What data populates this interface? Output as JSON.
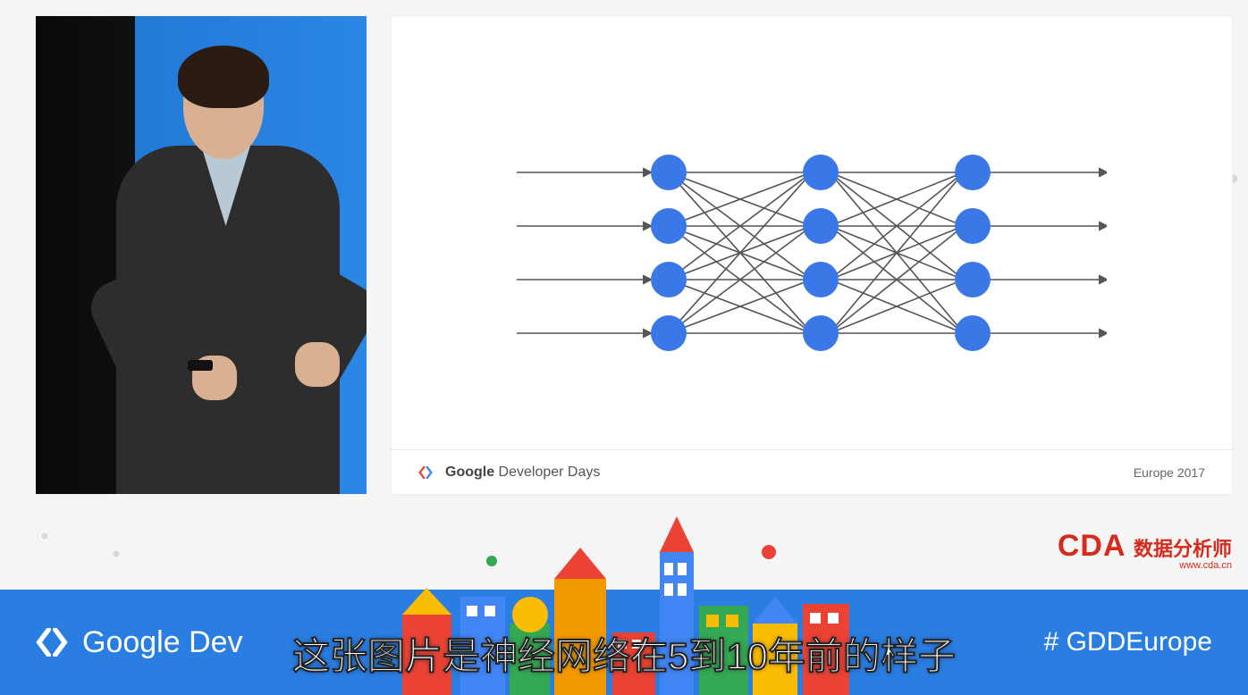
{
  "slide": {
    "footer_brand_bold": "Google",
    "footer_brand_rest": " Developer Days",
    "footer_right": "Europe 2017"
  },
  "bottom": {
    "brand": "Google Dev",
    "hashtag": "# GDDEurope"
  },
  "cda": {
    "logo_text": "CDA",
    "cn_text": "数据分析师",
    "url_text": "www.cda.cn"
  },
  "subtitle": "这张图片是神经网络在5到10年前的样子",
  "chart_data": {
    "type": "diagram",
    "description": "Fully-connected feedforward neural network schematic",
    "layers": [
      4,
      4,
      4
    ],
    "inputs": 4,
    "outputs": 4,
    "node_color": "#3b78e7",
    "edge_color": "#555555"
  }
}
